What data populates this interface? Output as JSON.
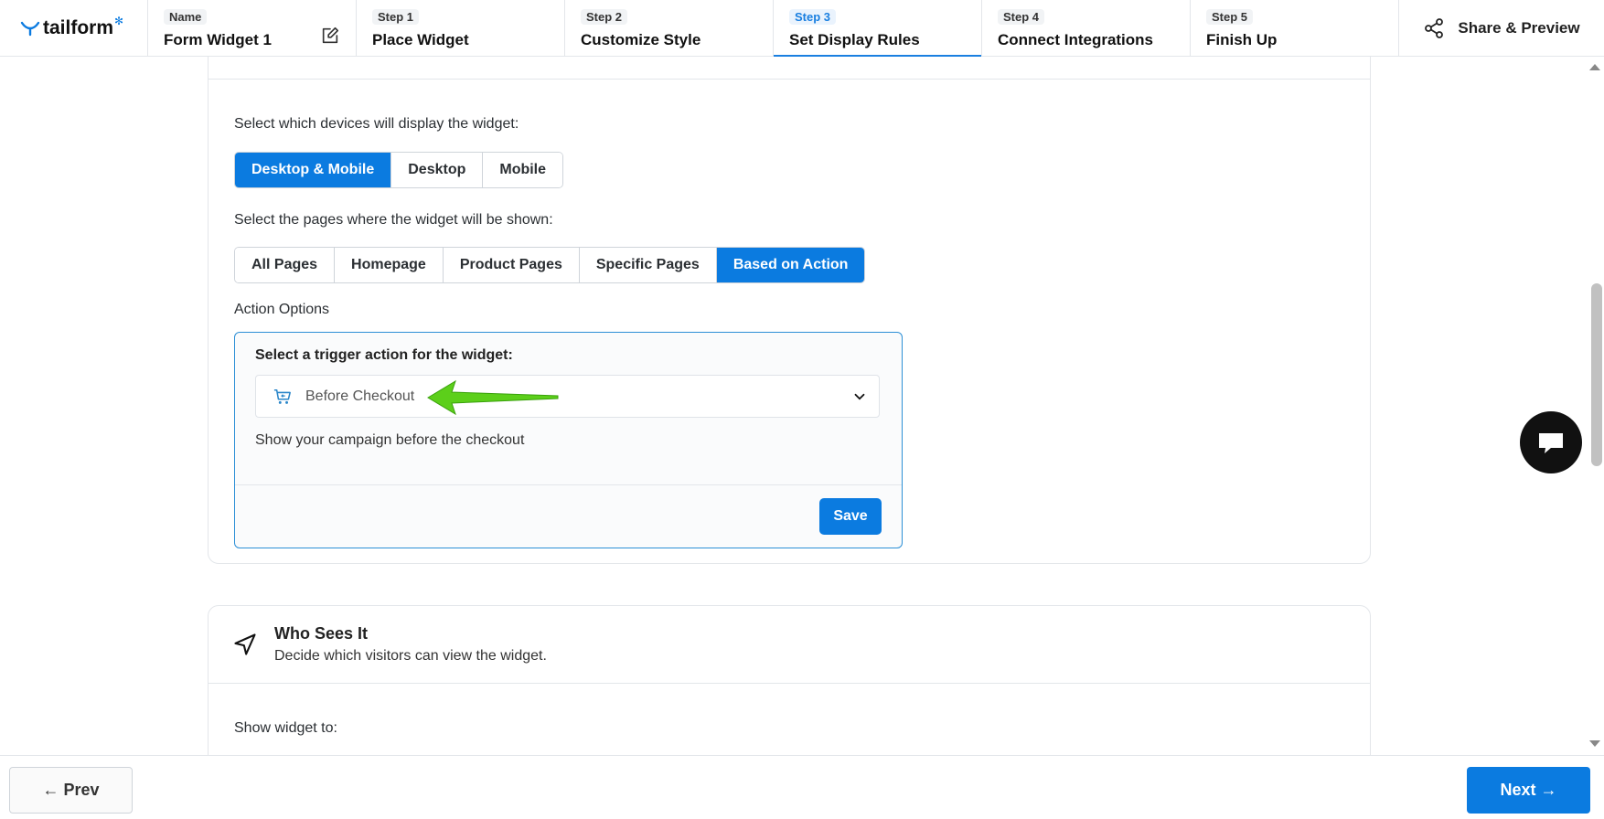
{
  "brand": {
    "name": "tailform",
    "accent": "#0b7be0"
  },
  "header": {
    "name_label": "Name",
    "name_value": "Form Widget 1",
    "steps": [
      {
        "label": "Step 1",
        "title": "Place Widget",
        "active": false
      },
      {
        "label": "Step 2",
        "title": "Customize Style",
        "active": false
      },
      {
        "label": "Step 3",
        "title": "Set Display Rules",
        "active": true
      },
      {
        "label": "Step 4",
        "title": "Connect Integrations",
        "active": false
      },
      {
        "label": "Step 5",
        "title": "Finish Up",
        "active": false
      }
    ],
    "share_label": "Share & Preview"
  },
  "display_rules": {
    "devices_prompt": "Select which devices will display the widget:",
    "device_options": [
      "Desktop & Mobile",
      "Desktop",
      "Mobile"
    ],
    "device_selected": "Desktop & Mobile",
    "pages_prompt": "Select the pages where the widget will be shown:",
    "page_options": [
      "All Pages",
      "Homepage",
      "Product Pages",
      "Specific Pages",
      "Based on Action"
    ],
    "page_selected": "Based on Action",
    "action_options_label": "Action Options",
    "action_box": {
      "title": "Select a trigger action for the widget:",
      "selected_action": "Before Checkout",
      "description": "Show your campaign before the checkout",
      "save_label": "Save"
    }
  },
  "who_sees_it": {
    "title": "Who Sees It",
    "subtitle": "Decide which visitors can view the widget.",
    "show_to_label": "Show widget to:"
  },
  "footer": {
    "prev_label": "← Prev",
    "next_label": "Next →"
  },
  "annotation_arrow_color": "#5ccf1a"
}
